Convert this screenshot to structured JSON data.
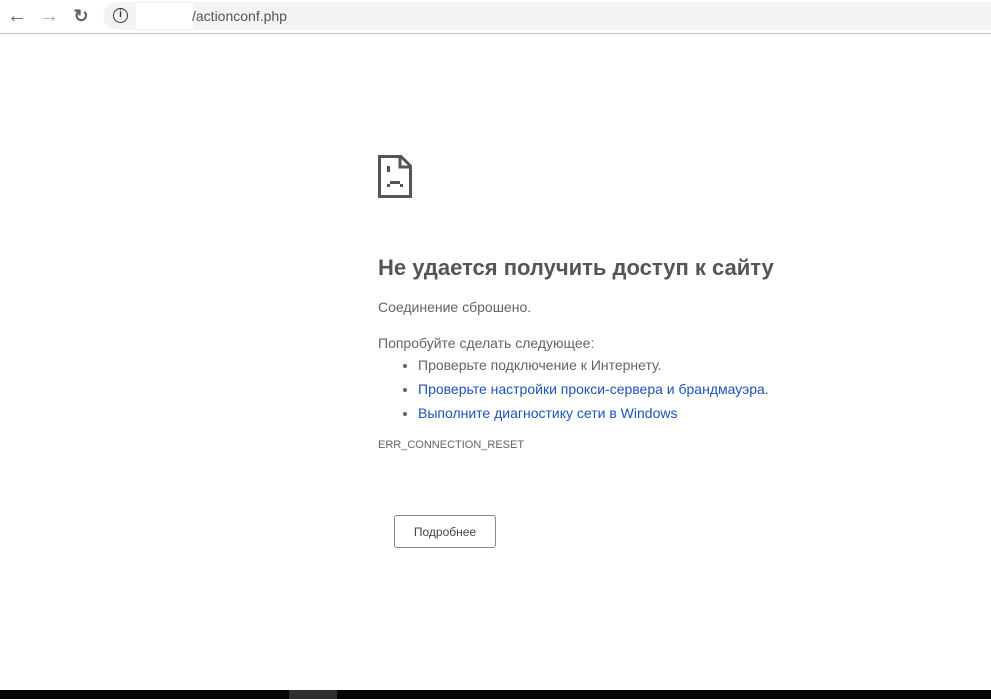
{
  "browser": {
    "url": "/actionconf.php",
    "back_icon": "arrow-left",
    "forward_icon": "arrow-right",
    "reload_icon": "reload",
    "info_icon": "info-circle"
  },
  "error": {
    "title": "Не удается получить доступ к сайту",
    "subtitle": "Соединение сброшено.",
    "suggest_heading": "Попробуйте сделать следующее:",
    "suggestions": [
      {
        "text": "Проверьте подключение к Интернету.",
        "link": false
      },
      {
        "text": "Проверьте настройки прокси-сервера и брандмауэра.",
        "link": true
      },
      {
        "text": "Выполните диагностику сети в Windows",
        "link": true
      }
    ],
    "code": "ERR_CONNECTION_RESET",
    "details_button": "Подробнее"
  },
  "colors": {
    "link": "#1a55b8",
    "text": "#646464"
  }
}
